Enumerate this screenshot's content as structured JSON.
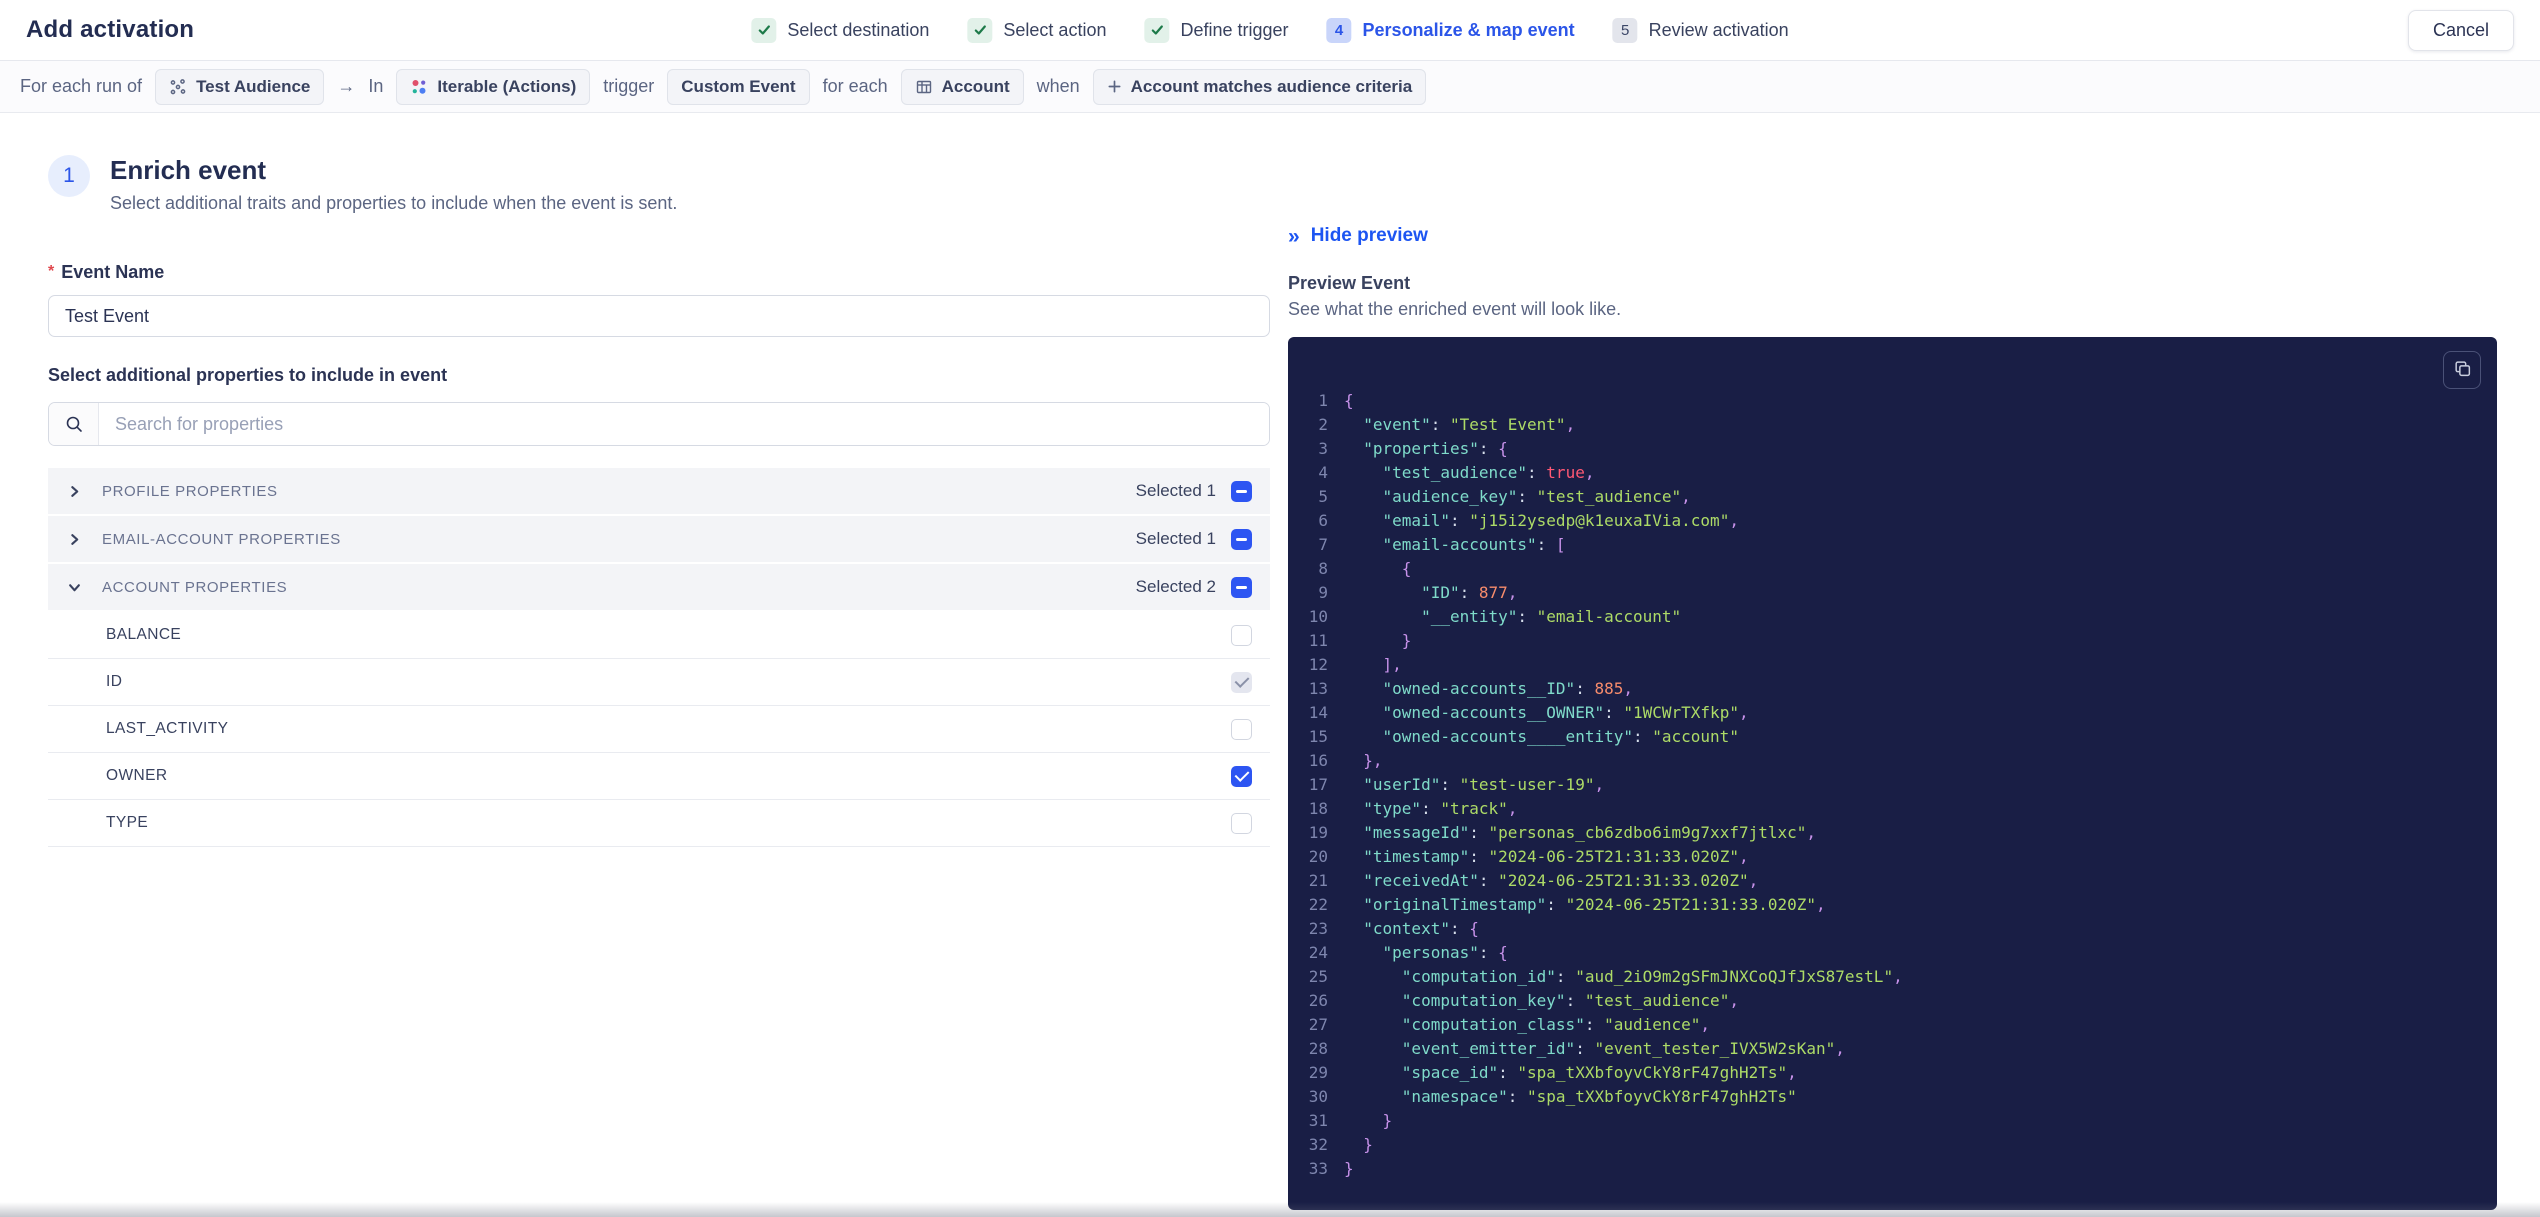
{
  "header": {
    "title": "Add activation",
    "cancel_label": "Cancel",
    "steps": [
      {
        "label": "Select destination",
        "status": "done",
        "badge": "✓"
      },
      {
        "label": "Select action",
        "status": "done",
        "badge": "✓"
      },
      {
        "label": "Define trigger",
        "status": "done",
        "badge": "✓"
      },
      {
        "label": "Personalize & map event",
        "status": "active",
        "badge": "4"
      },
      {
        "label": "Review activation",
        "status": "upcoming",
        "badge": "5"
      }
    ]
  },
  "context_bar": {
    "items": [
      {
        "type": "text",
        "text": "For each run of"
      },
      {
        "type": "chip",
        "icon": "audience-icon",
        "label": "Test Audience"
      },
      {
        "type": "text",
        "text": "→"
      },
      {
        "type": "text",
        "text": "In"
      },
      {
        "type": "chip",
        "icon": "iterable-icon",
        "label": "Iterable (Actions)"
      },
      {
        "type": "text",
        "text": "trigger"
      },
      {
        "type": "chip",
        "label": "Custom Event"
      },
      {
        "type": "text",
        "text": "for each"
      },
      {
        "type": "chip",
        "icon": "table-icon",
        "label": "Account"
      },
      {
        "type": "text",
        "text": "when"
      },
      {
        "type": "chip",
        "icon": "plus-icon",
        "label": "Account matches audience criteria"
      }
    ]
  },
  "enrich": {
    "step_number": "1",
    "title": "Enrich event",
    "description": "Select additional traits and properties to include when the event is sent.",
    "event_name_label": "Event Name",
    "event_name_value": "Test Event",
    "properties_label": "Select additional properties to include in event",
    "search_placeholder": "Search for properties"
  },
  "properties": {
    "sections": [
      {
        "name": "PROFILE PROPERTIES",
        "selected": "Selected 1",
        "expanded": false,
        "checkbox": "indeterminate",
        "rows": []
      },
      {
        "name": "EMAIL-ACCOUNT PROPERTIES",
        "selected": "Selected 1",
        "expanded": false,
        "checkbox": "indeterminate",
        "rows": []
      },
      {
        "name": "ACCOUNT PROPERTIES",
        "selected": "Selected 2",
        "expanded": true,
        "checkbox": "indeterminate",
        "rows": [
          {
            "label": "BALANCE",
            "checkbox": "unchecked"
          },
          {
            "label": "ID",
            "checkbox": "checked-disabled"
          },
          {
            "label": "LAST_ACTIVITY",
            "checkbox": "unchecked"
          },
          {
            "label": "OWNER",
            "checkbox": "checked"
          },
          {
            "label": "TYPE",
            "checkbox": "unchecked"
          }
        ]
      }
    ]
  },
  "preview": {
    "hide_label": "Hide preview",
    "title": "Preview Event",
    "description": "See what the enriched event will look like.",
    "code_lines": [
      {
        "indent": 0,
        "tokens": [
          [
            "p",
            "{"
          ]
        ]
      },
      {
        "indent": 2,
        "tokens": [
          [
            "k",
            "\"event\""
          ],
          [
            "c",
            ": "
          ],
          [
            "s",
            "\"Test Event\""
          ],
          [
            "p",
            ","
          ]
        ]
      },
      {
        "indent": 2,
        "tokens": [
          [
            "k",
            "\"properties\""
          ],
          [
            "c",
            ": "
          ],
          [
            "p",
            "{"
          ]
        ]
      },
      {
        "indent": 4,
        "tokens": [
          [
            "k",
            "\"test_audience\""
          ],
          [
            "c",
            ": "
          ],
          [
            "b",
            "true"
          ],
          [
            "p",
            ","
          ]
        ]
      },
      {
        "indent": 4,
        "tokens": [
          [
            "k",
            "\"audience_key\""
          ],
          [
            "c",
            ": "
          ],
          [
            "s",
            "\"test_audience\""
          ],
          [
            "p",
            ","
          ]
        ]
      },
      {
        "indent": 4,
        "tokens": [
          [
            "k",
            "\"email\""
          ],
          [
            "c",
            ": "
          ],
          [
            "s",
            "\"j15i2ysedp@k1euxaIVia.com\""
          ],
          [
            "p",
            ","
          ]
        ]
      },
      {
        "indent": 4,
        "tokens": [
          [
            "k",
            "\"email-accounts\""
          ],
          [
            "c",
            ": "
          ],
          [
            "p",
            "["
          ]
        ]
      },
      {
        "indent": 6,
        "tokens": [
          [
            "p",
            "{"
          ]
        ]
      },
      {
        "indent": 8,
        "tokens": [
          [
            "k",
            "\"ID\""
          ],
          [
            "c",
            ": "
          ],
          [
            "n",
            "877"
          ],
          [
            "p",
            ","
          ]
        ]
      },
      {
        "indent": 8,
        "tokens": [
          [
            "k",
            "\"__entity\""
          ],
          [
            "c",
            ": "
          ],
          [
            "s",
            "\"email-account\""
          ]
        ]
      },
      {
        "indent": 6,
        "tokens": [
          [
            "p",
            "}"
          ]
        ]
      },
      {
        "indent": 4,
        "tokens": [
          [
            "p",
            "],"
          ]
        ]
      },
      {
        "indent": 4,
        "tokens": [
          [
            "k",
            "\"owned-accounts__ID\""
          ],
          [
            "c",
            ": "
          ],
          [
            "n",
            "885"
          ],
          [
            "p",
            ","
          ]
        ]
      },
      {
        "indent": 4,
        "tokens": [
          [
            "k",
            "\"owned-accounts__OWNER\""
          ],
          [
            "c",
            ": "
          ],
          [
            "s",
            "\"1WCWrTXfkp\""
          ],
          [
            "p",
            ","
          ]
        ]
      },
      {
        "indent": 4,
        "tokens": [
          [
            "k",
            "\"owned-accounts____entity\""
          ],
          [
            "c",
            ": "
          ],
          [
            "s",
            "\"account\""
          ]
        ]
      },
      {
        "indent": 2,
        "tokens": [
          [
            "p",
            "},"
          ]
        ]
      },
      {
        "indent": 2,
        "tokens": [
          [
            "k",
            "\"userId\""
          ],
          [
            "c",
            ": "
          ],
          [
            "s",
            "\"test-user-19\""
          ],
          [
            "p",
            ","
          ]
        ]
      },
      {
        "indent": 2,
        "tokens": [
          [
            "k",
            "\"type\""
          ],
          [
            "c",
            ": "
          ],
          [
            "s",
            "\"track\""
          ],
          [
            "p",
            ","
          ]
        ]
      },
      {
        "indent": 2,
        "tokens": [
          [
            "k",
            "\"messageId\""
          ],
          [
            "c",
            ": "
          ],
          [
            "s",
            "\"personas_cb6zdbo6im9g7xxf7jtlxc\""
          ],
          [
            "p",
            ","
          ]
        ]
      },
      {
        "indent": 2,
        "tokens": [
          [
            "k",
            "\"timestamp\""
          ],
          [
            "c",
            ": "
          ],
          [
            "s",
            "\"2024-06-25T21:31:33.020Z\""
          ],
          [
            "p",
            ","
          ]
        ]
      },
      {
        "indent": 2,
        "tokens": [
          [
            "k",
            "\"receivedAt\""
          ],
          [
            "c",
            ": "
          ],
          [
            "s",
            "\"2024-06-25T21:31:33.020Z\""
          ],
          [
            "p",
            ","
          ]
        ]
      },
      {
        "indent": 2,
        "tokens": [
          [
            "k",
            "\"originalTimestamp\""
          ],
          [
            "c",
            ": "
          ],
          [
            "s",
            "\"2024-06-25T21:31:33.020Z\""
          ],
          [
            "p",
            ","
          ]
        ]
      },
      {
        "indent": 2,
        "tokens": [
          [
            "k",
            "\"context\""
          ],
          [
            "c",
            ": "
          ],
          [
            "p",
            "{"
          ]
        ]
      },
      {
        "indent": 4,
        "tokens": [
          [
            "k",
            "\"personas\""
          ],
          [
            "c",
            ": "
          ],
          [
            "p",
            "{"
          ]
        ]
      },
      {
        "indent": 6,
        "tokens": [
          [
            "k",
            "\"computation_id\""
          ],
          [
            "c",
            ": "
          ],
          [
            "s",
            "\"aud_2iO9m2gSFmJNXCoQJfJxS87estL\""
          ],
          [
            "p",
            ","
          ]
        ]
      },
      {
        "indent": 6,
        "tokens": [
          [
            "k",
            "\"computation_key\""
          ],
          [
            "c",
            ": "
          ],
          [
            "s",
            "\"test_audience\""
          ],
          [
            "p",
            ","
          ]
        ]
      },
      {
        "indent": 6,
        "tokens": [
          [
            "k",
            "\"computation_class\""
          ],
          [
            "c",
            ": "
          ],
          [
            "s",
            "\"audience\""
          ],
          [
            "p",
            ","
          ]
        ]
      },
      {
        "indent": 6,
        "tokens": [
          [
            "k",
            "\"event_emitter_id\""
          ],
          [
            "c",
            ": "
          ],
          [
            "s",
            "\"event_tester_IVX5W2sKan\""
          ],
          [
            "p",
            ","
          ]
        ]
      },
      {
        "indent": 6,
        "tokens": [
          [
            "k",
            "\"space_id\""
          ],
          [
            "c",
            ": "
          ],
          [
            "s",
            "\"spa_tXXbfoyvCkY8rF47ghH2Ts\""
          ],
          [
            "p",
            ","
          ]
        ]
      },
      {
        "indent": 6,
        "tokens": [
          [
            "k",
            "\"namespace\""
          ],
          [
            "c",
            ": "
          ],
          [
            "s",
            "\"spa_tXXbfoyvCkY8rF47ghH2Ts\""
          ]
        ]
      },
      {
        "indent": 4,
        "tokens": [
          [
            "p",
            "}"
          ]
        ]
      },
      {
        "indent": 2,
        "tokens": [
          [
            "p",
            "}"
          ]
        ]
      },
      {
        "indent": 0,
        "tokens": [
          [
            "p",
            "}"
          ]
        ]
      }
    ]
  },
  "colors": {
    "accent_blue": "#2b55e8",
    "checkbox_blue": "#2d55f2",
    "success_green": "#1d7a49",
    "code_background": "#191e45",
    "code_key": "#7fdbca",
    "code_string": "#addb67",
    "code_number": "#f78c6c",
    "code_boolean": "#ff5874",
    "code_punctuation": "#c792ea"
  }
}
